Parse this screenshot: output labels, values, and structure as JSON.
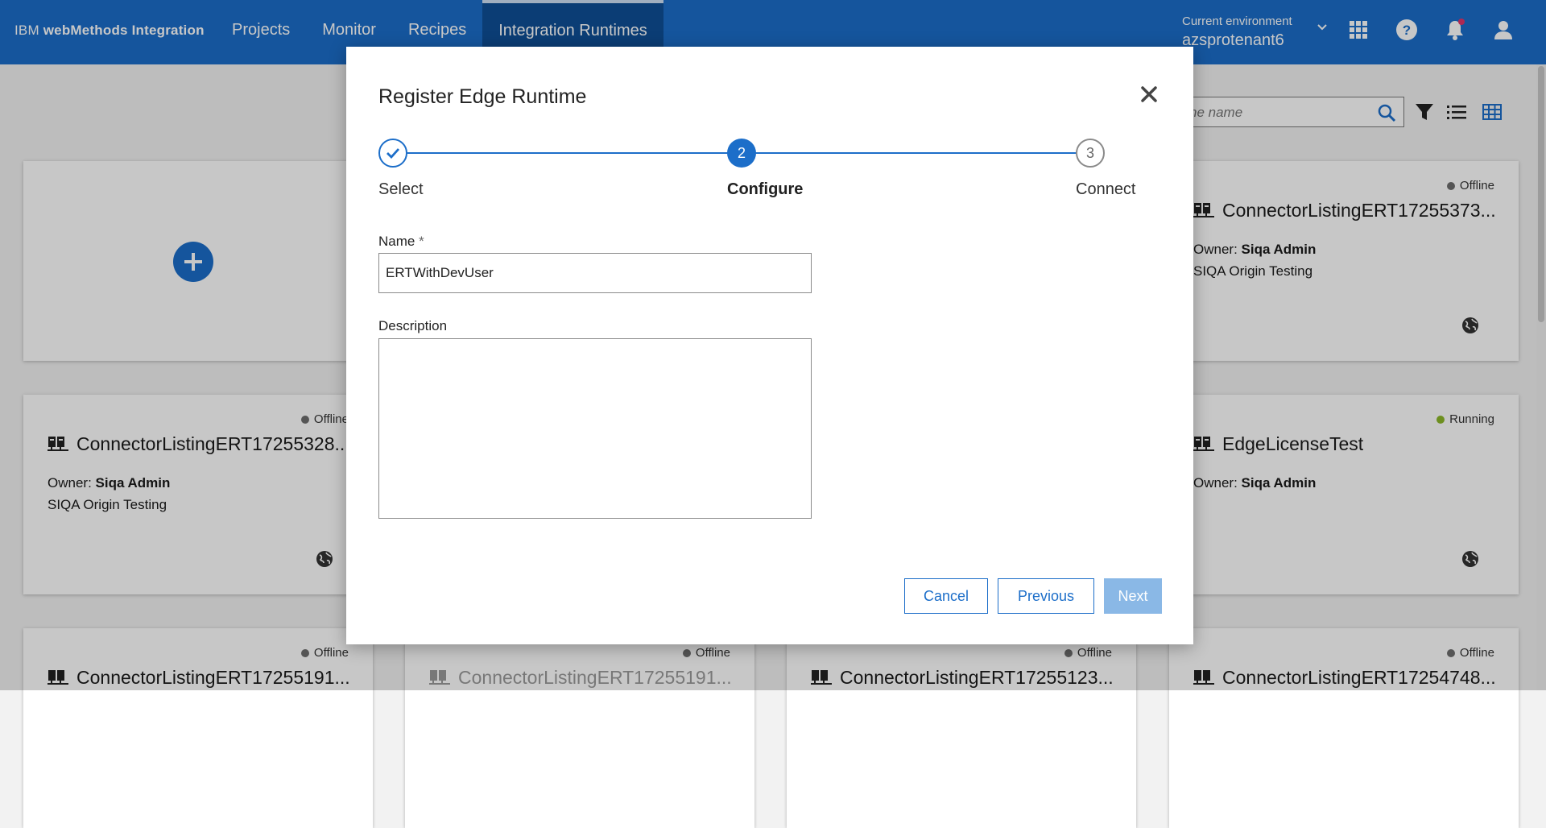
{
  "app": {
    "brand_prefix": "IBM ",
    "brand_name": "webMethods Integration"
  },
  "nav": {
    "items": [
      {
        "label": "Projects"
      },
      {
        "label": "Monitor"
      },
      {
        "label": "Recipes"
      },
      {
        "label": "Integration Runtimes",
        "active": true
      }
    ]
  },
  "environment": {
    "label": "Current environment",
    "value": "azsprotenant6"
  },
  "toolbar": {
    "search_placeholder": "ne name"
  },
  "cards": [
    {
      "status": "Offline",
      "title": "ConnectorListingERT17255373...",
      "owner_label": "Owner:",
      "owner": "Siqa Admin",
      "description": "SIQA Origin Testing"
    },
    {
      "status": "Offline",
      "title": "ConnectorListingERT17255328...",
      "owner_label": "Owner:",
      "owner": "Siqa Admin",
      "description": "SIQA Origin Testing"
    },
    {
      "status": "Running",
      "title": "EdgeLicenseTest",
      "owner_label": "Owner:",
      "owner": "Siqa Admin",
      "description": ""
    },
    {
      "status": "Offline",
      "title": "ConnectorListingERT17255191..."
    },
    {
      "status": "Offline",
      "title": "ConnectorListingERT17255191..."
    },
    {
      "status": "Offline",
      "title": "ConnectorListingERT17255123..."
    },
    {
      "status": "Offline",
      "title": "ConnectorListingERT17254748..."
    }
  ],
  "colors": {
    "brand": "#1c6ec9",
    "offline": "#6e6e6e",
    "running": "#8cb828"
  },
  "modal": {
    "title": "Register Edge Runtime",
    "steps": [
      {
        "number": "1",
        "label": "Select",
        "state": "complete"
      },
      {
        "number": "2",
        "label": "Configure",
        "state": "current"
      },
      {
        "number": "3",
        "label": "Connect",
        "state": "upcoming"
      }
    ],
    "name_label": "Name",
    "required_mark": "*",
    "name_value": "ERTWithDevUser",
    "description_label": "Description",
    "description_value": "",
    "buttons": {
      "cancel": "Cancel",
      "previous": "Previous",
      "next": "Next"
    }
  }
}
